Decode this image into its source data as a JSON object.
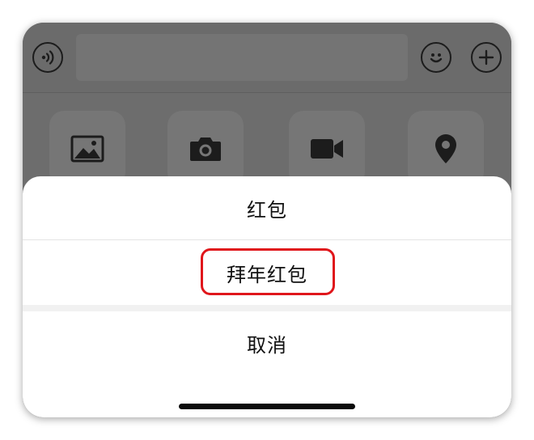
{
  "input_bar": {
    "voice_icon": "voice-icon",
    "emoji_icon": "emoji-icon",
    "plus_icon": "plus-icon"
  },
  "tray": {
    "tiles": [
      {
        "icon": "image-icon"
      },
      {
        "icon": "camera-icon"
      },
      {
        "icon": "video-camera-icon"
      },
      {
        "icon": "location-pin-icon"
      }
    ]
  },
  "action_sheet": {
    "items": [
      {
        "label": "红包"
      },
      {
        "label": "拜年红包"
      }
    ],
    "cancel_label": "取消",
    "highlight_color": "#e0161b"
  }
}
